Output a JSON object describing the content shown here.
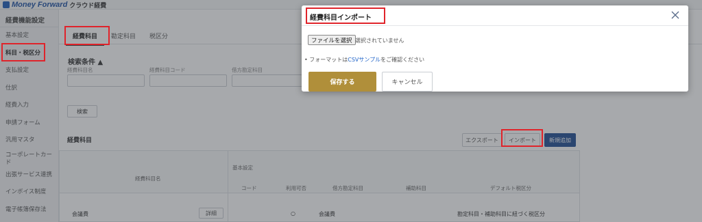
{
  "app": {
    "brand": "Money Forward",
    "product": "クラウド経費"
  },
  "sidebar": {
    "header": "経費機能設定",
    "items": [
      {
        "label": "基本設定"
      },
      {
        "label": "科目・税区分"
      },
      {
        "label": "支払設定"
      },
      {
        "label": "仕訳"
      },
      {
        "label": "経費入力"
      },
      {
        "label": "申請フォーム"
      },
      {
        "label": "汎用マスタ"
      },
      {
        "label": "コーポレートカード"
      },
      {
        "label": "出張サービス連携"
      },
      {
        "label": "インボイス制度"
      },
      {
        "label": "電子帳簿保存法"
      }
    ]
  },
  "tabs": [
    {
      "label": "経費科目"
    },
    {
      "label": "勘定科目"
    },
    {
      "label": "税区分"
    }
  ],
  "search": {
    "title": "検索条件 ▲",
    "fields": [
      {
        "label": "経費科目名"
      },
      {
        "label": "経費科目コード"
      },
      {
        "label": "借方勘定科目"
      }
    ],
    "button": "検索"
  },
  "list": {
    "title": "経費科目",
    "export_button": "エクスポート",
    "import_button": "インポート",
    "new_button": "新規追加"
  },
  "table": {
    "headers": {
      "name": "経費科目名",
      "basic": "基本設定",
      "code": "コード",
      "usable": "利用可否",
      "debit": "借方勘定科目",
      "sub": "補助科目",
      "tax": "デフォルト税区分"
    },
    "rows": [
      {
        "name": "会議費",
        "detail": "詳細",
        "code": "",
        "usable": "○",
        "debit": "会議費",
        "sub": "",
        "tax": "勘定科目・補助科目に紐づく税区分"
      }
    ]
  },
  "modal": {
    "title": "経費科目インポート",
    "file_button": "ファイルを選択",
    "file_status": "選択されていません",
    "format_prefix": "• フォーマットは",
    "format_link": "CSVサンプル",
    "format_suffix": "をご確認ください",
    "save_button": "保存する",
    "cancel_button": "キャンセル"
  }
}
